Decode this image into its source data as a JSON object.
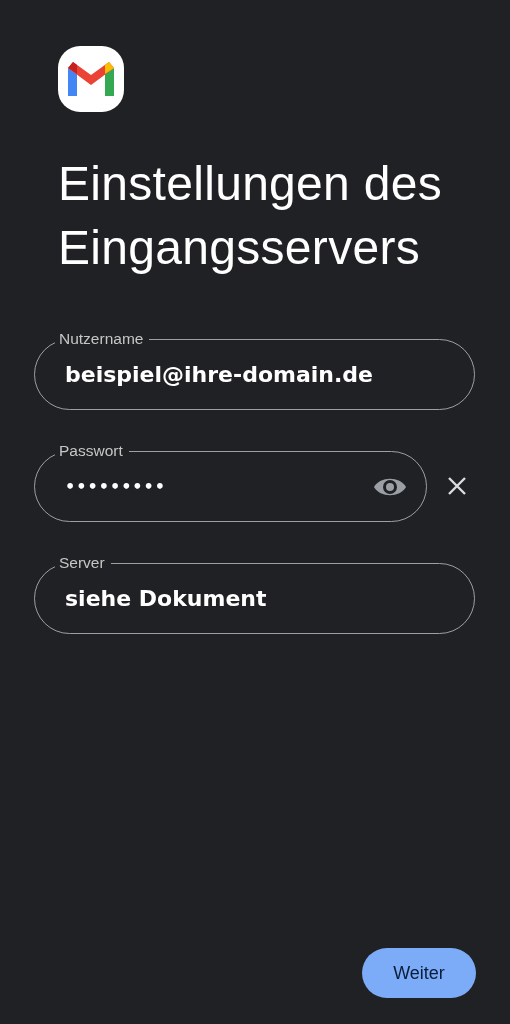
{
  "title": "Einstellungen des Eingangsservers",
  "fields": [
    {
      "kind": "text",
      "label": "Nutzername",
      "value": "beispiel@ihre-domain.de"
    },
    {
      "kind": "password",
      "label": "Passwort",
      "value": "•••••••••"
    },
    {
      "kind": "text",
      "label": "Server",
      "value": "siehe Dokument"
    }
  ],
  "next_button": "Weiter"
}
